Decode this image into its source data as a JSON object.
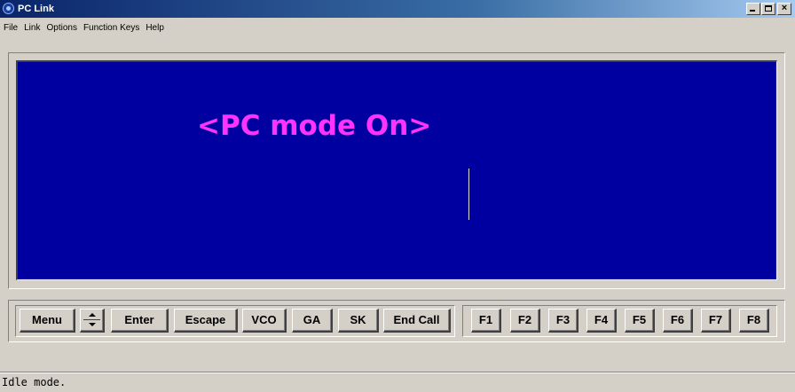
{
  "window": {
    "title": "PC Link"
  },
  "menu": {
    "items": [
      {
        "label": "File"
      },
      {
        "label": "Link"
      },
      {
        "label": "Options"
      },
      {
        "label": "Function Keys"
      },
      {
        "label": "Help"
      }
    ]
  },
  "display": {
    "text": "<PC mode On>",
    "background_color": "#0000a0",
    "text_color": "#ff33ff"
  },
  "keys": {
    "menu": "Menu",
    "enter": "Enter",
    "escape": "Escape",
    "vco": "VCO",
    "ga": "GA",
    "sk": "SK",
    "end_call": "End Call",
    "f1": "F1",
    "f2": "F2",
    "f3": "F3",
    "f4": "F4",
    "f5": "F5",
    "f6": "F6",
    "f7": "F7",
    "f8": "F8"
  },
  "status": {
    "text": "Idle mode."
  }
}
